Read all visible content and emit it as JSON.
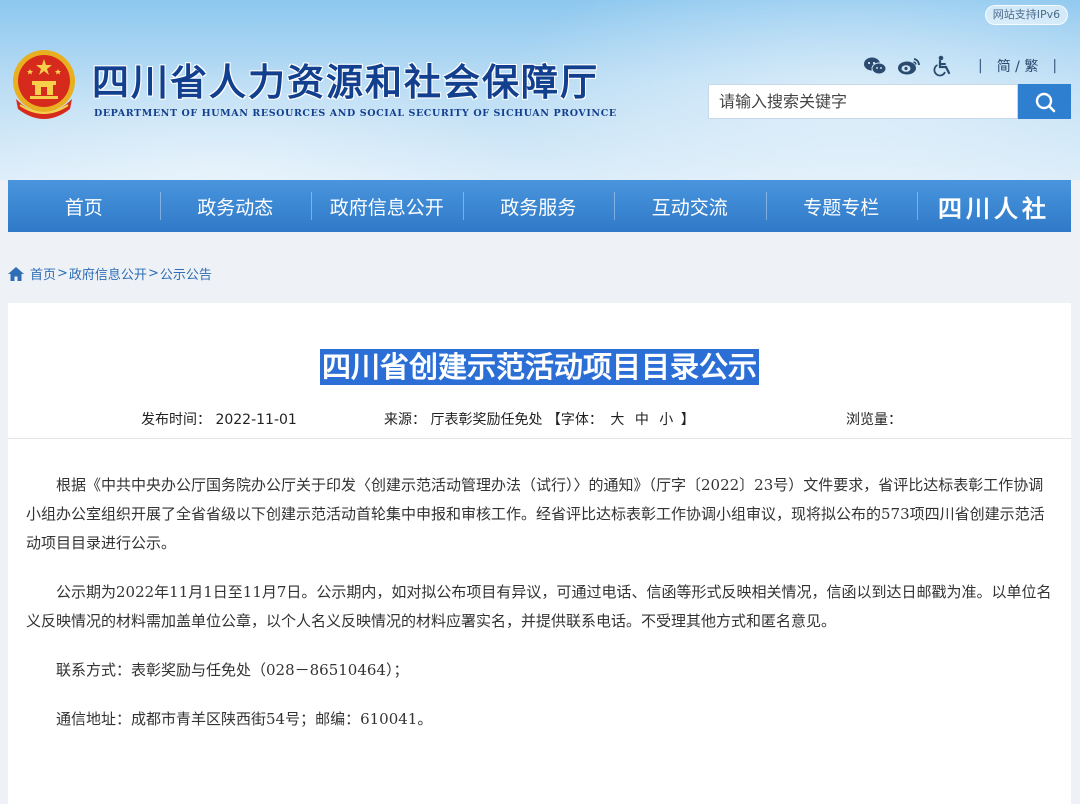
{
  "header": {
    "title": "四川省人力资源和社会保障厅",
    "subtitle": "DEPARTMENT OF HUMAN RESOURCES AND SOCIAL SECURITY OF SICHUAN PROVINCE",
    "ipv6_badge": "网站支持IPv6",
    "lang_switch": "简 / 繁",
    "search_placeholder": "请输入搜索关键字",
    "tool_icons": [
      "wechat-icon",
      "weibo-icon",
      "accessibility-icon"
    ]
  },
  "nav": {
    "items": [
      "首页",
      "政务动态",
      "政府信息公开",
      "政务服务",
      "互动交流",
      "专题专栏"
    ],
    "logo_text": "四川人社"
  },
  "breadcrumb": {
    "home": "首页",
    "level1": "政府信息公开",
    "level2": "公示公告",
    "separator": ">"
  },
  "article": {
    "title": "四川省创建示范活动项目目录公示",
    "date_label": "发布时间：",
    "date": "2022-11-01",
    "source_label": "来源：",
    "source": "厅表彰奖励任免处",
    "font_label": "【字体：",
    "font_large": "大",
    "font_medium": "中",
    "font_small": "小",
    "font_close": "】",
    "views_label": "浏览量：",
    "paragraphs": [
      "根据《中共中央办公厅国务院办公厅关于印发〈创建示范活动管理办法（试行）〉的通知》（厅字〔2022〕23号）文件要求，省评比达标表彰工作协调小组办公室组织开展了全省省级以下创建示范活动首轮集中申报和审核工作。经省评比达标表彰工作协调小组审议，现将拟公布的573项四川省创建示范活动项目目录进行公示。",
      "公示期为2022年11月1日至11月7日。公示期内，如对拟公布项目有异议，可通过电话、信函等形式反映相关情况，信函以到达日邮戳为准。以单位名义反映情况的材料需加盖单位公章，以个人名义反映情况的材料应署实名，并提供联系电话。不受理其他方式和匿名意见。",
      "联系方式：表彰奖励与任免处（028－86510464）；",
      "通信地址：成都市青羊区陕西街54号；邮编：610041。"
    ]
  },
  "colors": {
    "nav_blue": "#3a86d3",
    "title_highlight": "#2b6fd6",
    "title_text": "#13408e",
    "link_blue": "#2f6db5"
  }
}
